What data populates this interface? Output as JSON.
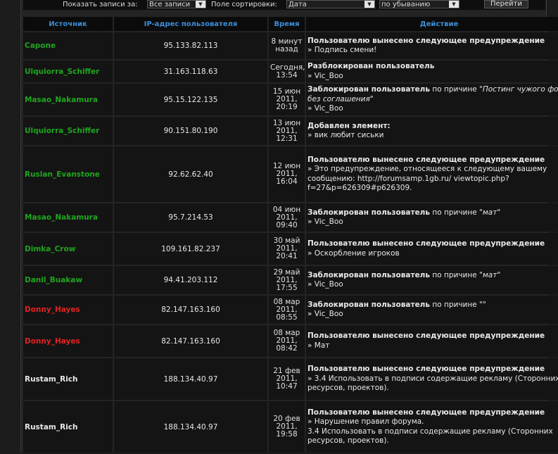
{
  "filter": {
    "show_label": "Показать записи за:",
    "period_value": "Все записи",
    "sort_label": "Поле сортировки:",
    "sort_value": "Дата",
    "order_value": "по убыванию",
    "go_label": "Перейти"
  },
  "colors": {
    "green": "#1fa51f",
    "red": "#e82020",
    "white": "#e8e8e8",
    "header": "#3d8ed8"
  },
  "table": {
    "headers": [
      "Источник",
      "IP-адрес пользователя",
      "Время",
      "Действие"
    ],
    "rows": [
      {
        "source": "Capone",
        "color": "green",
        "ip": "95.133.82.113",
        "time": [
          "8 минут",
          "назад"
        ],
        "bold": "Пользователю вынесено следующее предупреждение",
        "mid": "",
        "reason": "",
        "tail": "",
        "detail": [
          "» Подпись смени!"
        ]
      },
      {
        "source": "Ulquiorra_Schiffer",
        "color": "green",
        "ip": "31.163.118.63",
        "time": [
          "Сегодня,",
          "13:54"
        ],
        "bold": "Разблокирован пользователь",
        "mid": "",
        "reason": "",
        "tail": "",
        "detail": [
          "» Vic_Boo"
        ]
      },
      {
        "source": "Masao_Nakamura",
        "color": "green",
        "ip": "95.15.122.135",
        "time": [
          "15 июн",
          "2011,",
          "20:19"
        ],
        "bold": "Заблокирован пользователь",
        "mid": " по причине \"",
        "reason": "Постинг чужого фото без соглашения",
        "tail": "\"",
        "detail": [
          "» Vic_Boo"
        ]
      },
      {
        "source": "Ulquiorra_Schiffer",
        "color": "green",
        "ip": "90.151.80.190",
        "time": [
          "13 июн",
          "2011,",
          "12:31"
        ],
        "bold": "Добавлен элемент:",
        "mid": "",
        "reason": "",
        "tail": "",
        "detail": [
          "» вик любит сиськи"
        ]
      },
      {
        "source": "Ruslan_Evanstone",
        "color": "green",
        "ip": "92.62.62.40",
        "time": [
          "12 июн",
          "2011,",
          "16:04"
        ],
        "bold": "Пользователю вынесено следующее предупреждение",
        "mid": "",
        "reason": "",
        "tail": "",
        "detail": [
          "» Это предупреждение, относящееся к следующему вашему сообщению: http://forumsamp.1gb.ru/ viewtopic.php?f=27&p=626309#p626309."
        ]
      },
      {
        "source": "Masao_Nakamura",
        "color": "green",
        "ip": "95.7.214.53",
        "time": [
          "04 июн",
          "2011,",
          "09:40"
        ],
        "bold": "Заблокирован пользователь",
        "mid": " по причине \"",
        "reason": "мат",
        "tail": "\"",
        "detail": [
          "» Vic_Boo"
        ]
      },
      {
        "source": "Dimka_Crow",
        "color": "green",
        "ip": "109.161.82.237",
        "time": [
          "30 май",
          "2011,",
          "20:41"
        ],
        "bold": "Пользователю вынесено следующее предупреждение",
        "mid": "",
        "reason": "",
        "tail": "",
        "detail": [
          "» Оскорбление игроков"
        ]
      },
      {
        "source": "Danil_Buakaw",
        "color": "green",
        "ip": "94.41.203.112",
        "time": [
          "29 май",
          "2011,",
          "17:55"
        ],
        "bold": "Заблокирован пользователь",
        "mid": " по причине \"",
        "reason": "мат",
        "tail": "\"",
        "detail": [
          "» Vic_Boo"
        ]
      },
      {
        "source": "Donny_Hayes",
        "color": "red",
        "ip": "82.147.163.160",
        "time": [
          "08 мар",
          "2011,",
          "08:55"
        ],
        "bold": "Заблокирован пользователь",
        "mid": " по причине \"\"",
        "reason": "",
        "tail": "",
        "detail": [
          "» Vic_Boo"
        ]
      },
      {
        "source": "Donny_Hayes",
        "color": "red",
        "ip": "82.147.163.160",
        "time": [
          "08 мар",
          "2011,",
          "08:42"
        ],
        "bold": "Пользователю вынесено следующее предупреждение",
        "mid": "",
        "reason": "",
        "tail": "",
        "detail": [
          "» Мат"
        ]
      },
      {
        "source": "Rustam_Rich",
        "color": "white",
        "ip": "188.134.40.97",
        "time": [
          "21 фев",
          "2011,",
          "10:47"
        ],
        "bold": "Пользователю вынесено следующее предупреждение",
        "mid": "",
        "reason": "",
        "tail": "",
        "detail": [
          "» 3.4 Использовать в подписи содержащие рекламу (Сторонних ресурсов, проектов)."
        ]
      },
      {
        "source": "Rustam_Rich",
        "color": "white",
        "ip": "188.134.40.97",
        "time": [
          "20 фев",
          "2011,",
          "19:58"
        ],
        "bold": "Пользователю вынесено следующее предупреждение",
        "mid": "",
        "reason": "",
        "tail": "",
        "detail": [
          "» Нарушение правил форума.",
          "3.4 Использовать в подписи содержащие рекламу (Сторонних ресурсов, проектов)."
        ]
      }
    ]
  }
}
